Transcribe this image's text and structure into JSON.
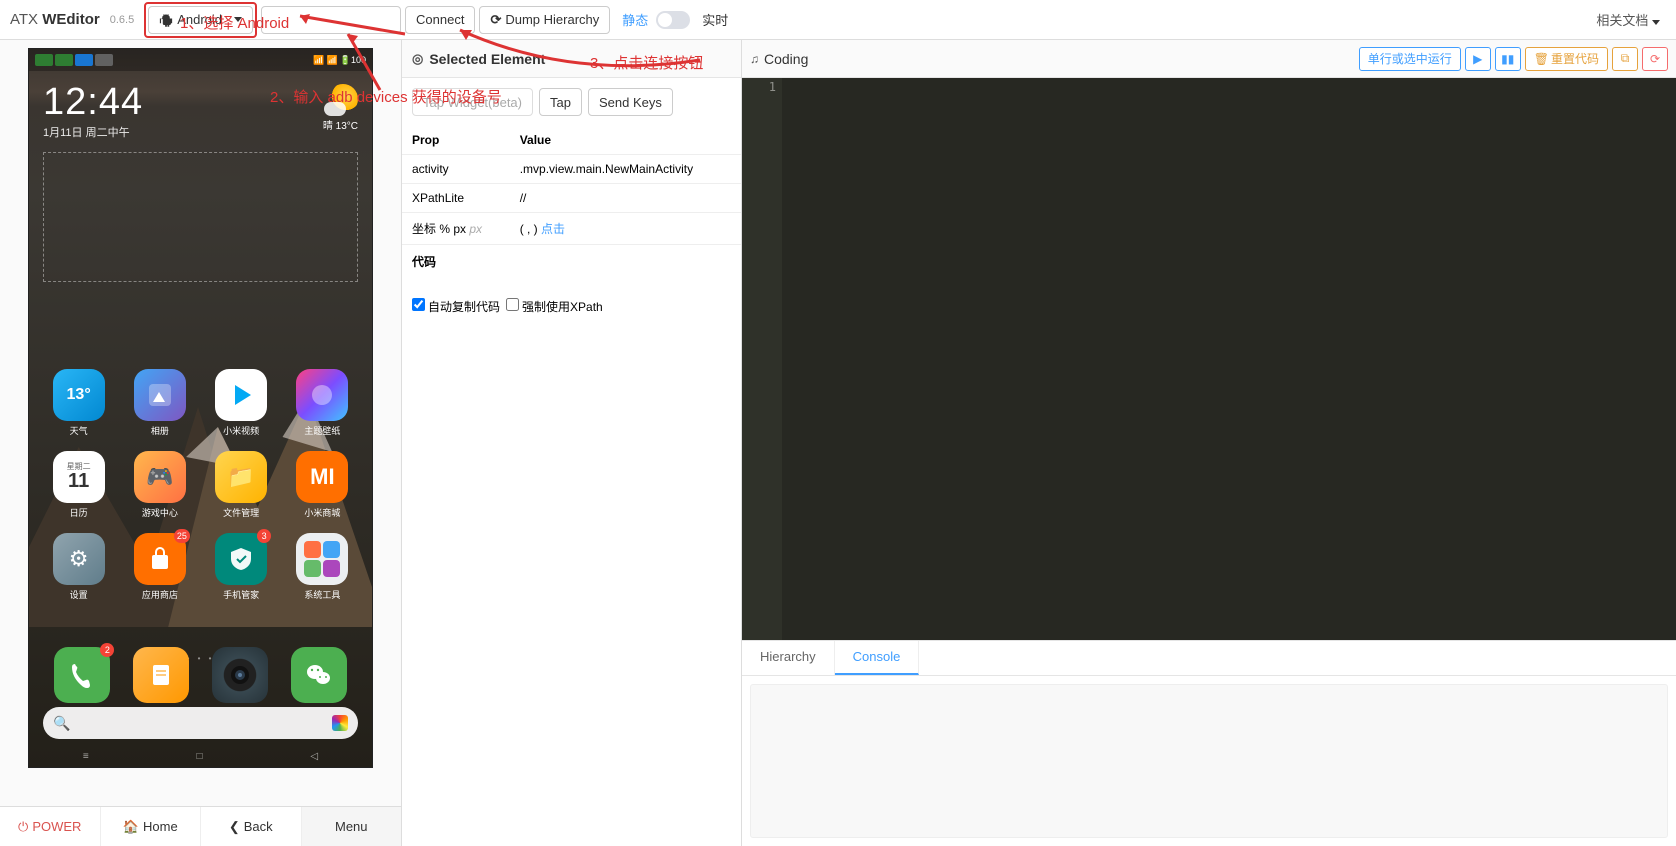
{
  "brand": {
    "prefix": "ATX ",
    "name": "WEditor",
    "version": "0.6.5"
  },
  "toolbar": {
    "platform": "Android",
    "connect": "Connect",
    "dump": "Dump Hierarchy",
    "static": "静态",
    "realtime": "实时",
    "docs": "相关文档"
  },
  "annotations": {
    "a1": "1、选择 Android",
    "a2": "2、输入 adb devices 获得的设备号",
    "a3": "3、点击连接按钮"
  },
  "phone": {
    "clock": "12:44",
    "date": "1月11日 周二中午",
    "weather_cond": "晴",
    "weather_temp": "13°C",
    "temp_badge": "13°",
    "cal_day_label": "星期二",
    "cal_day_num": "11",
    "page_dots": "• • •",
    "nav": {
      "menu": "≡",
      "home": "□",
      "back": "◁"
    },
    "apps": [
      {
        "label": "天气",
        "cls": "bg-weather",
        "badge": ""
      },
      {
        "label": "相册",
        "cls": "bg-gallery",
        "badge": ""
      },
      {
        "label": "小米视频",
        "cls": "bg-video",
        "badge": ""
      },
      {
        "label": "主题壁纸",
        "cls": "bg-theme",
        "badge": ""
      },
      {
        "label": "日历",
        "cls": "bg-cal",
        "badge": ""
      },
      {
        "label": "游戏中心",
        "cls": "bg-game",
        "badge": ""
      },
      {
        "label": "文件管理",
        "cls": "bg-files",
        "badge": ""
      },
      {
        "label": "小米商城",
        "cls": "bg-mi",
        "badge": ""
      },
      {
        "label": "设置",
        "cls": "bg-settings",
        "badge": ""
      },
      {
        "label": "应用商店",
        "cls": "bg-store",
        "badge": "25"
      },
      {
        "label": "手机管家",
        "cls": "bg-security",
        "badge": "3"
      },
      {
        "label": "系统工具",
        "cls": "bg-systools",
        "badge": ""
      }
    ],
    "dock": [
      {
        "cls": "bg-phone",
        "badge": "2"
      },
      {
        "cls": "bg-notes",
        "badge": ""
      },
      {
        "cls": "bg-camera",
        "badge": ""
      },
      {
        "cls": "bg-wechat",
        "badge": ""
      }
    ]
  },
  "controls": {
    "power": "POWER",
    "home": "Home",
    "back": "Back",
    "menu": "Menu"
  },
  "midpanel": {
    "title": "Selected Element",
    "tap_widget": "Tap Widget(beta)",
    "tap": "Tap",
    "send_keys": "Send Keys",
    "table": {
      "h1": "Prop",
      "h2": "Value",
      "r1k": "activity",
      "r1v": ".mvp.view.main.NewMainActivity",
      "r2k": "XPathLite",
      "r2v": "//",
      "r3k": "坐标 % px",
      "r3v_prefix": "( , ) ",
      "r3v_link": "点击"
    },
    "code_label": "代码",
    "check1": "自动复制代码",
    "check2": "强制使用XPath"
  },
  "coding": {
    "title": "Coding",
    "run": "单行或选中运行",
    "reset": "重置代码",
    "line1": "1",
    "tab_hierarchy": "Hierarchy",
    "tab_console": "Console"
  }
}
